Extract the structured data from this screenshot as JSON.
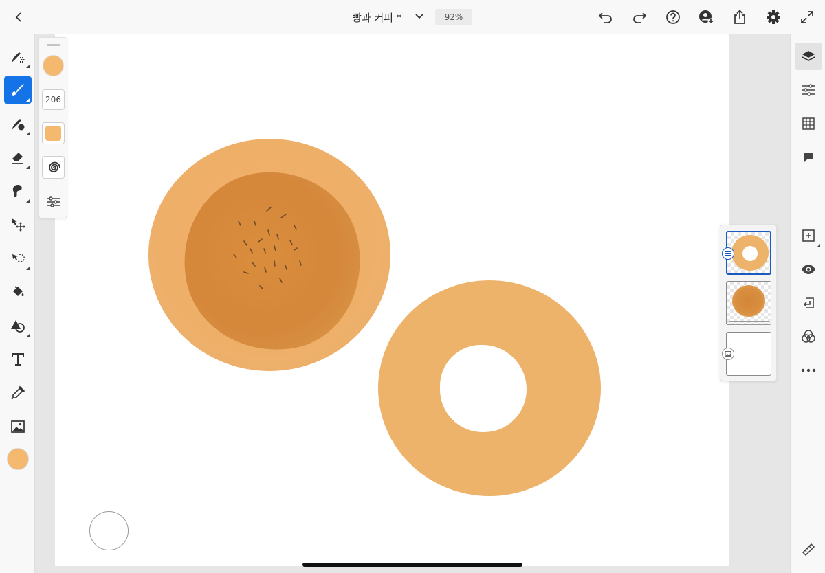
{
  "document": {
    "title": "빵과 커피 *",
    "zoom": "92%"
  },
  "brush": {
    "size": "206",
    "color": "#f4b86e"
  },
  "colors": {
    "accent": "#1473e6",
    "bun_light": "#eeaf69",
    "bun_dark": "#d5873a",
    "donut": "#eeb36a",
    "seed": "#6e4a2a"
  },
  "topbar": {
    "icons": [
      "back-icon",
      "chevron-down-icon",
      "undo-icon",
      "redo-icon",
      "help-icon",
      "invite-icon",
      "share-icon",
      "settings-icon",
      "fullscreen-icon"
    ]
  },
  "left_tools": [
    "smudge-tool",
    "paint-brush-tool",
    "mixer-brush-tool",
    "eraser-tool",
    "liquify-tool",
    "move-tool",
    "lasso-select-tool",
    "fill-tool",
    "shape-tool",
    "text-tool",
    "eyedropper-tool",
    "image-tool"
  ],
  "right_tools": [
    "layers-icon",
    "adjustments-icon",
    "grid-icon",
    "comments-icon",
    "add-layer-icon",
    "visibility-icon",
    "import-icon",
    "blend-mode-icon",
    "more-icon",
    "ruler-icon"
  ],
  "layers": {
    "count": 3,
    "selected_index": 0
  }
}
